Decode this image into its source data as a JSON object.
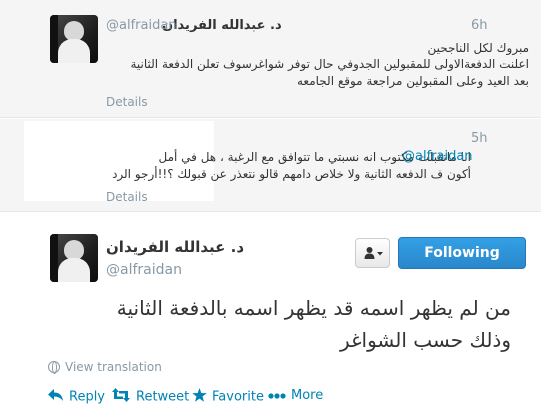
{
  "tweet1": {
    "name": "د. عبدالله الفريدان",
    "handle": "@alfraidan",
    "time": "6h",
    "lines": [
      "مبروك لكل الناجحين",
      "اعلنت الدفعةالاولى للمقبولين الجدوفي حال توفر شواغرسوف تعلن الدفعة الثانية",
      "بعد العيد وعلى المقبولين مراجعة موقع الجامعه"
    ],
    "details": "Details"
  },
  "tweet2": {
    "time": "5h",
    "mention": "@alfraidan",
    "line1": "انا ماتقبلت مكتوب انه نسبتي ما تتوافق مع الرغبة ، هل في أمل",
    "line2": "أكون ف الدفعه الثانية ولا خلاص دامهم قالو نتعذر عن قبولك ؟!!أرجو الرد",
    "details": "Details"
  },
  "main": {
    "name": "د. عبدالله الفريدان",
    "handle": "@alfraidan",
    "follow_label": "Following",
    "text_line1": "من لم يظهر اسمه قد يظهر اسمه بالدفعة الثانية",
    "text_line2": "وذلك حسب الشواغر",
    "view_translation": "View translation",
    "actions": {
      "reply": "Reply",
      "retweet": "Retweet",
      "favorite": "Favorite",
      "more": "More"
    }
  },
  "colors": {
    "link": "#0084b4",
    "muted": "#8899a6",
    "follow_button": "#2a87cc"
  }
}
